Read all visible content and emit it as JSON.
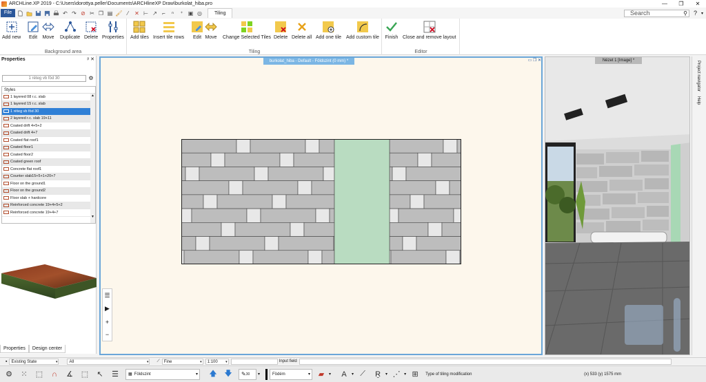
{
  "window": {
    "title": "ARCHLine.XP 2019 - C:\\Users\\dorottya.peller\\Documents\\ARCHlineXP Draw\\burkolat_hiba.pro",
    "minimize": "—",
    "maximize": "❐",
    "close": "✕"
  },
  "qat": {
    "file_label": "File",
    "active_tab": "Tiling",
    "search_placeholder": "Search",
    "help": "?"
  },
  "ribbon": {
    "groups": [
      {
        "label": "Background area",
        "buttons": [
          "Add new",
          "Edit",
          "Move",
          "Duplicate",
          "Delete",
          "Properties"
        ]
      },
      {
        "label": "Tiling",
        "buttons": [
          "Add tiles",
          "Insert tile rows",
          "Edit",
          "Move",
          "Change Selected Tiles",
          "Delete",
          "Delete all",
          "Add one tile",
          "Add custom tile"
        ]
      },
      {
        "label": "Editor",
        "buttons": [
          "Finish",
          "Close and remove layout"
        ]
      }
    ]
  },
  "properties": {
    "header": "Properties",
    "pin": "ᵖ ✕",
    "style_input": "1 réteg vb föd 30",
    "styles_header": "Styles",
    "styles": [
      "1 layered 08 r.c. slab",
      "1 layered 15 r.c. slab",
      "1 réteg vb föd 30",
      "2 layered r.c. slab 19+11",
      "Coated drift 4+5+2",
      "Coated drift 4+7",
      "Coated flat roof1",
      "Coated floor1",
      "Coated floor2",
      "Coated green roof",
      "Concrete flat roof1",
      "Counter slab15+5+1+20+7",
      "Floor on the ground1",
      "Floor on the ground2",
      "Floor slab + hardcore",
      "Reinforced concrete 19+4+5+2",
      "Reinforced concrete 19+4+7"
    ],
    "selected_index": 2,
    "tabs": [
      "Properties",
      "Design center"
    ]
  },
  "view2d": {
    "title": "burkolat_hiba - Default - Földszint (0 mm) *",
    "controls": "▭ ❐ ✕"
  },
  "view3d": {
    "title": "Nézet 1 [Image] *"
  },
  "right_strip": {
    "tabs": [
      "Project navigator",
      "Help"
    ]
  },
  "statusbar": {
    "state": "Existing State",
    "layer": "All",
    "line": "Fine",
    "scale": "1:100",
    "input_label": "Input field"
  },
  "bottombar": {
    "floor": "Földszint",
    "pen": "30",
    "material": "Födém",
    "hint": "Type of tiling modification",
    "coords": "(x) 533   (y) 1575 mm"
  },
  "colors": {
    "accent": "#2b579a",
    "tile_dark": "#bdbdbd",
    "tile_light": "#e8e8e8",
    "tile_green": "#b9dcc1",
    "view_border": "#6aa6d8"
  }
}
